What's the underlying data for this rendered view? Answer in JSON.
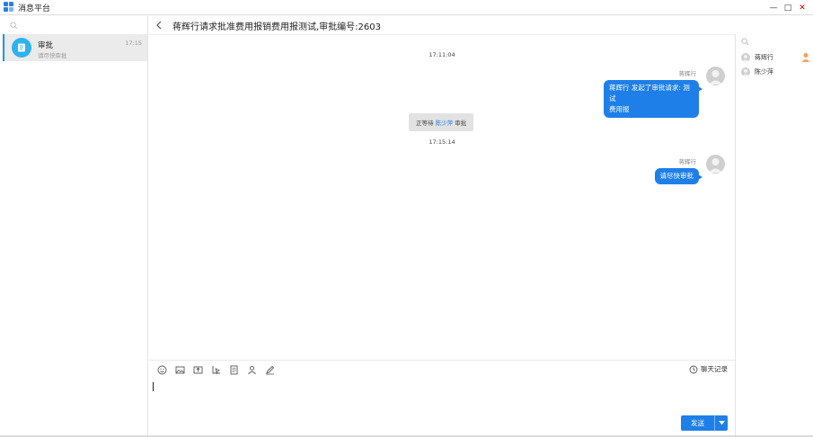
{
  "window": {
    "title": "消息平台",
    "controls": {
      "minimize": "—",
      "maximize": "□",
      "close": "✕"
    }
  },
  "conversations": [
    {
      "name": "审批",
      "preview": "请尽快审批",
      "time": "17:15",
      "icon": "approval-icon"
    }
  ],
  "chat": {
    "title": "蒋辉行请求批准费用报销费用报测试,审批编号:2603",
    "messages": [
      {
        "type": "timestamp",
        "text": "17:11:04"
      },
      {
        "type": "bubble",
        "sender": "蒋辉行",
        "lines": [
          "蒋辉行 发起了审批请求: 测试",
          "费用报"
        ]
      },
      {
        "type": "notice",
        "prefix": "正等待 ",
        "highlight": "陈少萍",
        "suffix": " 审批"
      },
      {
        "type": "timestamp",
        "text": "17:15:14"
      },
      {
        "type": "bubble",
        "sender": "蒋辉行",
        "lines": [
          "请尽快审批"
        ]
      }
    ]
  },
  "members": [
    {
      "name": "蒋辉行",
      "badge": "admin-user-icon"
    },
    {
      "name": "陈少萍"
    }
  ],
  "input": {
    "tools": [
      "emoji-icon",
      "image-icon",
      "upload-icon",
      "screenshot-icon",
      "document-icon",
      "contact-card-icon",
      "sign-icon"
    ],
    "history_label": "聊天记录",
    "send_label": "发送"
  },
  "colors": {
    "accent": "#1e7fe8",
    "conversation_icon": "#2db3ee",
    "highlight": "#2b7de9"
  }
}
